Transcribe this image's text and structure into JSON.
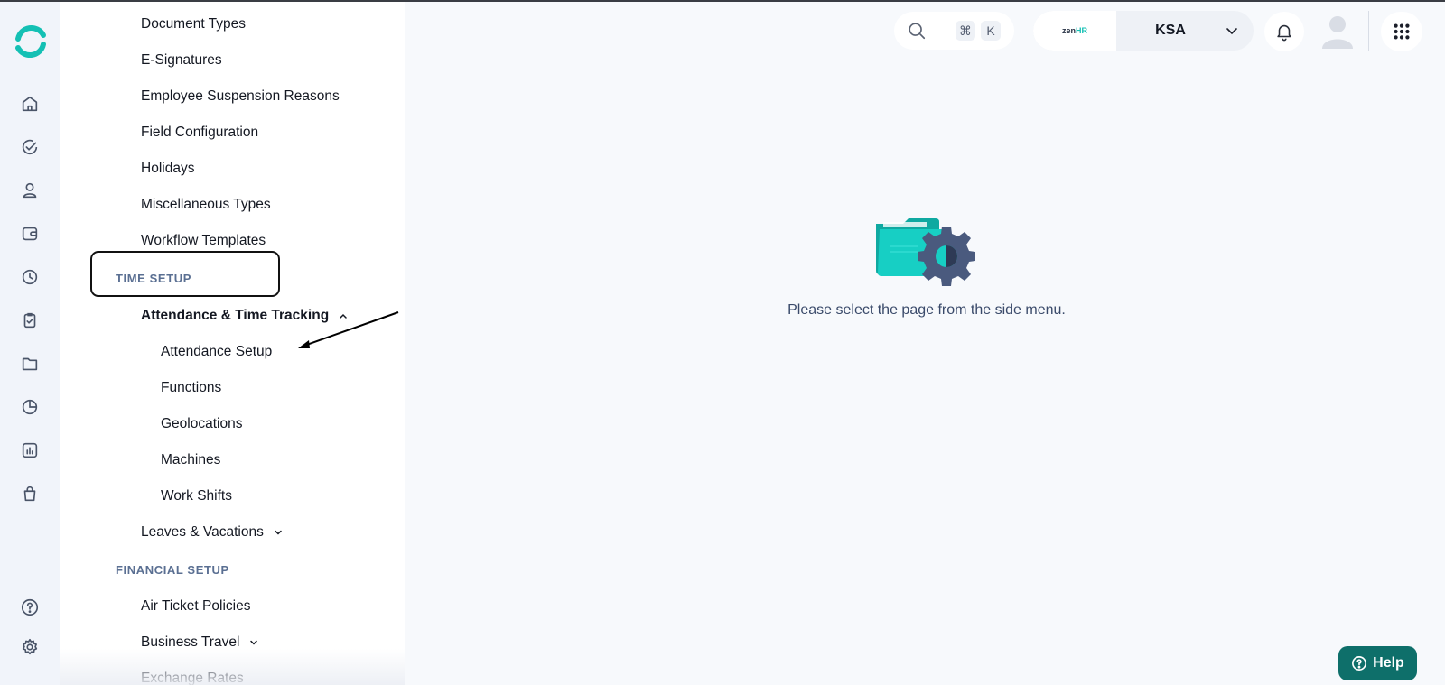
{
  "rail": {
    "icons": [
      "home-icon",
      "check-circle-icon",
      "user-icon",
      "wallet-icon",
      "clock-icon",
      "clipboard-check-icon",
      "folder-icon",
      "pie-chart-icon",
      "bar-chart-icon",
      "shopping-bag-icon",
      "help-circle-icon",
      "gear-icon"
    ]
  },
  "menu": {
    "items_top": [
      "Document Types",
      "E-Signatures",
      "Employee Suspension Reasons",
      "Field Configuration",
      "Holidays",
      "Miscellaneous Types",
      "Workflow Templates"
    ],
    "time_setup_label": "TIME SETUP",
    "attendance_group": "Attendance & Time Tracking",
    "attendance_items": [
      "Attendance Setup",
      "Functions",
      "Geolocations",
      "Machines",
      "Work Shifts"
    ],
    "leaves_group": "Leaves & Vacations",
    "financial_setup_label": "FINANCIAL SETUP",
    "financial_items": [
      "Air Ticket Policies"
    ],
    "business_travel": "Business Travel",
    "exchange_rates": "Exchange Rates"
  },
  "topbar": {
    "shortcut_cmd": "⌘",
    "shortcut_key": "K",
    "brand_left": "zen",
    "brand_right": "HR",
    "company_name": "KSA"
  },
  "main": {
    "empty_message": "Please select the page from the side menu."
  },
  "help_label": "Help",
  "colors": {
    "accent": "#14c0b4",
    "help_bg": "#0e6f6a",
    "section": "#5a6f92"
  }
}
